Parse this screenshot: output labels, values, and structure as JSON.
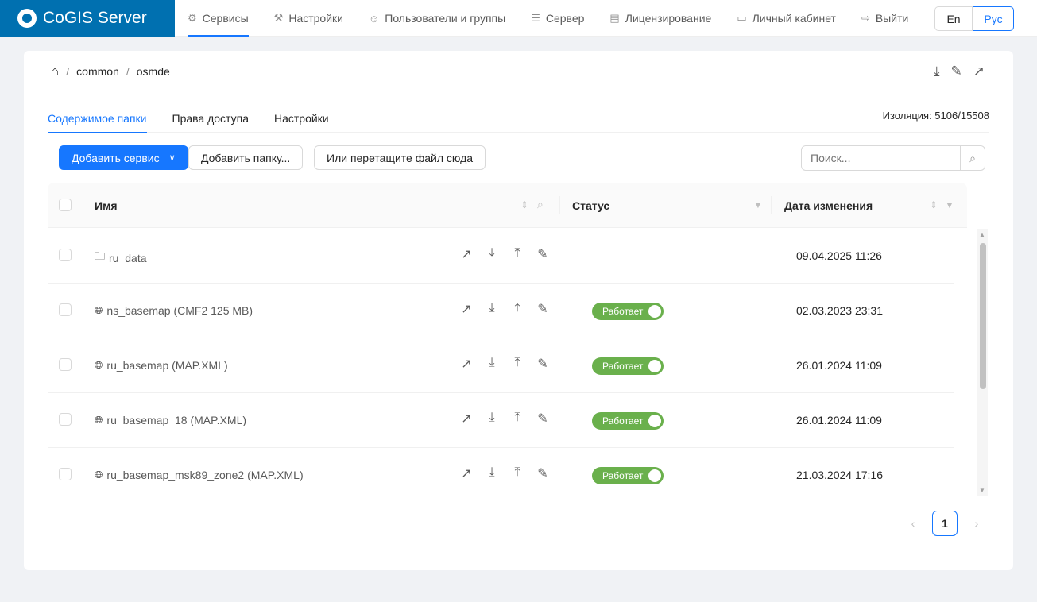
{
  "app": {
    "title": "CoGIS Server"
  },
  "nav": [
    {
      "label": "Сервисы",
      "icon": "gear-icon",
      "active": true
    },
    {
      "label": "Настройки",
      "icon": "magic-wand-icon"
    },
    {
      "label": "Пользователи и группы",
      "icon": "user-icon"
    },
    {
      "label": "Сервер",
      "icon": "database-icon"
    },
    {
      "label": "Лицензирование",
      "icon": "license-icon"
    },
    {
      "label": "Личный кабинет",
      "icon": "briefcase-icon"
    },
    {
      "label": "Выйти",
      "icon": "logout-icon"
    }
  ],
  "lang": {
    "en": "En",
    "ru": "Рус",
    "selected": "Рус"
  },
  "breadcrumb": [
    "common",
    "osmde"
  ],
  "tabs": [
    "Содержимое папки",
    "Права доступа",
    "Настройки"
  ],
  "isolation": "Изоляция: 5106/15508",
  "toolbar": {
    "add_service": "Добавить сервис",
    "add_folder": "Добавить папку...",
    "drop": "Или перетащите файл сюда",
    "search_placeholder": "Поиск..."
  },
  "table": {
    "headers": {
      "name": "Имя",
      "status": "Статус",
      "date": "Дата изменения"
    },
    "rows": [
      {
        "name": "ru_data",
        "type": "",
        "icon": "folder-icon",
        "status": "",
        "date": "09.04.2025 11:26"
      },
      {
        "name": "ns_basemap",
        "type": "(CMF2 125 MB)",
        "icon": "globe-icon",
        "status": "Работает",
        "date": "02.03.2023 23:31"
      },
      {
        "name": "ru_basemap",
        "type": "(MAP.XML)",
        "icon": "globe-icon",
        "status": "Работает",
        "date": "26.01.2024 11:09"
      },
      {
        "name": "ru_basemap_18",
        "type": "(MAP.XML)",
        "icon": "globe-icon",
        "status": "Работает",
        "date": "26.01.2024 11:09"
      },
      {
        "name": "ru_basemap_msk89_zone2",
        "type": "(MAP.XML)",
        "icon": "globe-icon",
        "status": "Работает",
        "date": "21.03.2024 17:16"
      }
    ]
  },
  "pagination": {
    "current": "1"
  },
  "colors": {
    "brand": "#0070b0",
    "accent": "#1677ff",
    "status_on": "#6ab04c"
  }
}
